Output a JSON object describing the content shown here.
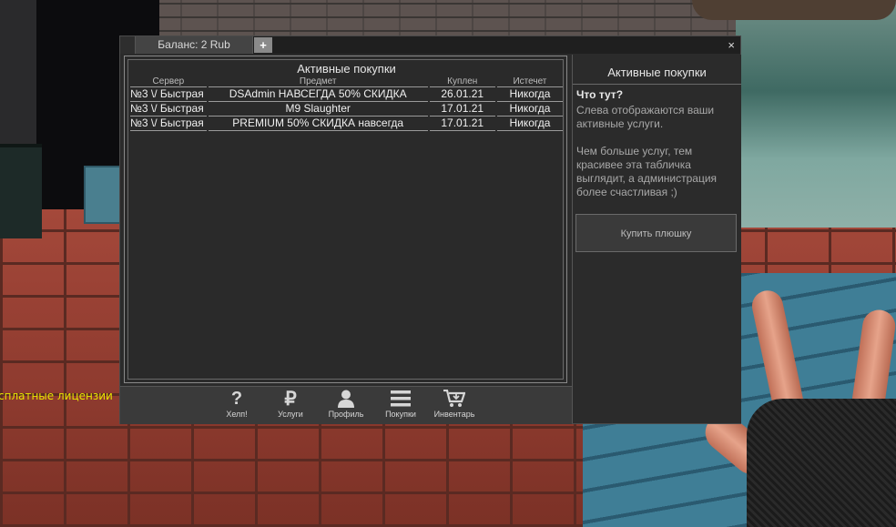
{
  "window": {
    "balance_tab": "Баланс: 2 Rub",
    "add_tab": "+",
    "close": "×"
  },
  "left_panel": {
    "title": "Активные покупки",
    "columns": [
      "Сервер",
      "Предмет",
      "Куплен",
      "Истечет"
    ],
    "rows": [
      {
        "server": "№3 \\/ Быстрая",
        "item": "DSAdmin НАВСЕГДА 50% СКИДКА",
        "bought": "26.01.21",
        "expires": "Никогда"
      },
      {
        "server": "№3 \\/ Быстрая",
        "item": "M9 Slaughter",
        "bought": "17.01.21",
        "expires": "Никогда"
      },
      {
        "server": "№3 \\/ Быстрая",
        "item": "PREMIUM 50% СКИДКА навсегда",
        "bought": "17.01.21",
        "expires": "Никогда"
      }
    ]
  },
  "nav": {
    "items": [
      {
        "label": "Хелп!",
        "icon": "question-icon"
      },
      {
        "label": "Услуги",
        "icon": "ruble-icon"
      },
      {
        "label": "Профиль",
        "icon": "user-icon"
      },
      {
        "label": "Покупки",
        "icon": "list-icon"
      },
      {
        "label": "Инвентарь",
        "icon": "cart-icon"
      }
    ]
  },
  "right_panel": {
    "title": "Активные покупки",
    "question": "Что тут?",
    "paragraph1": "Слева отображаются ваши активные услуги.",
    "paragraph2": "Чем больше услуг, тем красивее эта табличка выглядит, а администрация более счастливая ;)",
    "button": "Купить плюшку"
  },
  "hud": {
    "red_text": "...",
    "yellow_text": "сплатные лицензии"
  },
  "colors": {
    "panel_bg": "#2b2b2b",
    "text_light": "#f0f0f0",
    "text_muted": "#a8a8a8",
    "hud_yellow": "#e8e400"
  }
}
